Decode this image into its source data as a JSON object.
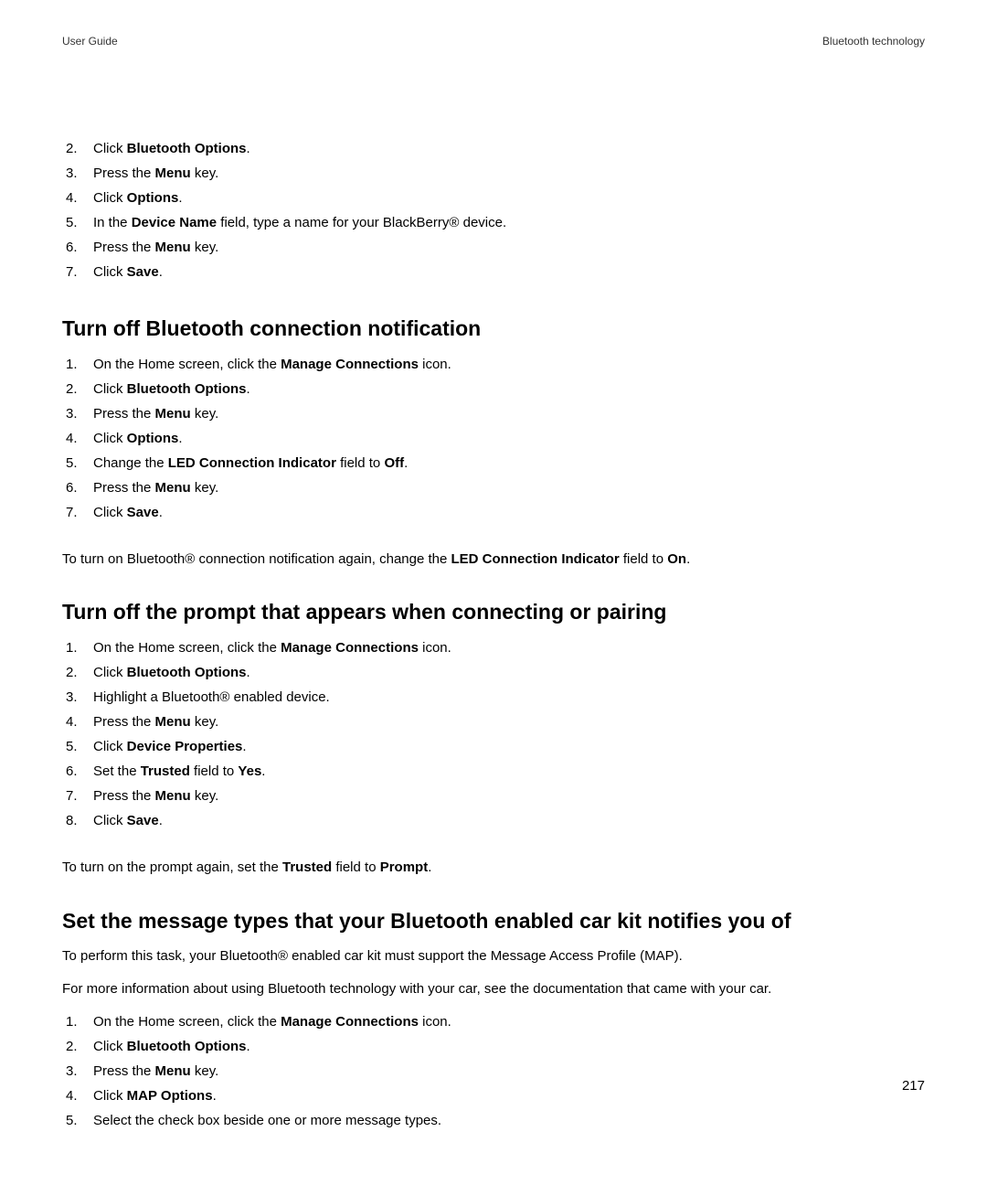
{
  "header": {
    "left": "User Guide",
    "right": "Bluetooth technology"
  },
  "section0": {
    "steps": [
      {
        "num": "2.",
        "parts": [
          "Click ",
          "Bluetooth Options",
          "."
        ]
      },
      {
        "num": "3.",
        "parts": [
          "Press the ",
          "Menu",
          " key."
        ]
      },
      {
        "num": "4.",
        "parts": [
          "Click ",
          "Options",
          "."
        ]
      },
      {
        "num": "5.",
        "parts": [
          "In the ",
          "Device Name",
          " field, type a name for your BlackBerry® device."
        ]
      },
      {
        "num": "6.",
        "parts": [
          "Press the ",
          "Menu",
          " key."
        ]
      },
      {
        "num": "7.",
        "parts": [
          "Click ",
          "Save",
          "."
        ]
      }
    ]
  },
  "section1": {
    "heading": "Turn off Bluetooth connection notification",
    "steps": [
      {
        "num": "1.",
        "parts": [
          "On the Home screen, click the ",
          "Manage Connections",
          " icon."
        ]
      },
      {
        "num": "2.",
        "parts": [
          "Click ",
          "Bluetooth Options",
          "."
        ]
      },
      {
        "num": "3.",
        "parts": [
          "Press the ",
          "Menu",
          " key."
        ]
      },
      {
        "num": "4.",
        "parts": [
          "Click ",
          "Options",
          "."
        ]
      },
      {
        "num": "5.",
        "parts": [
          "Change the ",
          "LED Connection Indicator",
          " field to ",
          "Off",
          "."
        ]
      },
      {
        "num": "6.",
        "parts": [
          "Press the ",
          "Menu",
          " key."
        ]
      },
      {
        "num": "7.",
        "parts": [
          "Click ",
          "Save",
          "."
        ]
      }
    ],
    "note_parts": [
      "To turn on Bluetooth® connection notification again, change the ",
      "LED Connection Indicator",
      " field to ",
      "On",
      "."
    ]
  },
  "section2": {
    "heading": "Turn off the prompt that appears when connecting or pairing",
    "steps": [
      {
        "num": "1.",
        "parts": [
          "On the Home screen, click the ",
          "Manage Connections",
          " icon."
        ]
      },
      {
        "num": "2.",
        "parts": [
          "Click ",
          "Bluetooth Options",
          "."
        ]
      },
      {
        "num": "3.",
        "parts": [
          "Highlight a Bluetooth® enabled device."
        ]
      },
      {
        "num": "4.",
        "parts": [
          "Press the ",
          "Menu",
          " key."
        ]
      },
      {
        "num": "5.",
        "parts": [
          "Click ",
          "Device Properties",
          "."
        ]
      },
      {
        "num": "6.",
        "parts": [
          "Set the ",
          "Trusted",
          " field to ",
          "Yes",
          "."
        ]
      },
      {
        "num": "7.",
        "parts": [
          "Press the ",
          "Menu",
          " key."
        ]
      },
      {
        "num": "8.",
        "parts": [
          "Click ",
          "Save",
          "."
        ]
      }
    ],
    "note_parts": [
      "To turn on the prompt again, set the ",
      "Trusted",
      " field to ",
      "Prompt",
      "."
    ]
  },
  "section3": {
    "heading": "Set the message types that your Bluetooth enabled car kit notifies you of",
    "intro1": "To perform this task, your Bluetooth® enabled car kit must support the Message Access Profile (MAP).",
    "intro2": "For more information about using Bluetooth technology with your car, see the documentation that came with your car.",
    "steps": [
      {
        "num": "1.",
        "parts": [
          "On the Home screen, click the ",
          "Manage Connections",
          " icon."
        ]
      },
      {
        "num": "2.",
        "parts": [
          "Click ",
          "Bluetooth Options",
          "."
        ]
      },
      {
        "num": "3.",
        "parts": [
          "Press the ",
          "Menu",
          " key."
        ]
      },
      {
        "num": "4.",
        "parts": [
          "Click ",
          "MAP Options",
          "."
        ]
      },
      {
        "num": "5.",
        "parts": [
          "Select the check box beside one or more message types."
        ]
      }
    ]
  },
  "page_number": "217"
}
